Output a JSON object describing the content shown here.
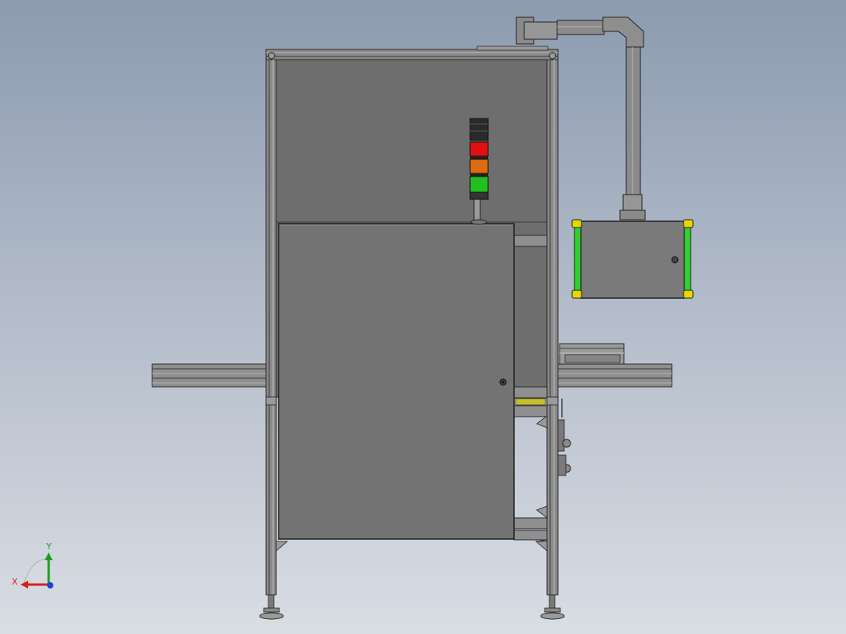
{
  "triad": {
    "x_label": "X",
    "y_label": "Y",
    "x_color": "#d42020",
    "y_color": "#1aa01a",
    "z_color": "#2040d8"
  },
  "colors": {
    "background_top": "#8c9bb0",
    "background_bottom": "#d9dde4",
    "cabinet_panel": "#6e6e6e",
    "frame_aluminum": "#8a8a8a",
    "signal_red": "#e01010",
    "signal_orange": "#e06a10",
    "signal_green": "#20c020",
    "signal_black": "#222222",
    "enclosure_trim_green": "#30d030",
    "enclosure_corner_yellow": "#e6d800",
    "conveyor_highlight_yellow": "#c8c02a"
  }
}
